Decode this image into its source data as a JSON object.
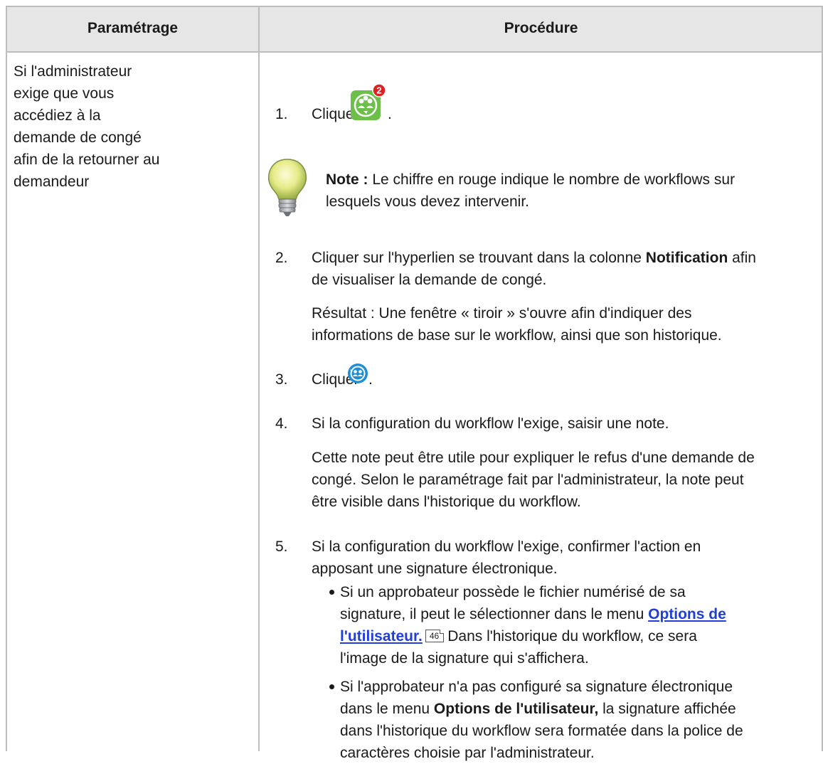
{
  "table": {
    "headers": {
      "col1": "Paramétrage",
      "col2": "Procédure"
    },
    "setting": [
      "Si l'administrateur",
      "exige que vous",
      "accédiez à la",
      "demande de congé",
      "afin de la retourner au",
      "demandeur"
    ],
    "steps": {
      "s1": {
        "num": "1.",
        "text": "Cliquer",
        "badge": "2",
        "after": "."
      },
      "note": {
        "label": "Note :",
        "line1": " Le chiffre en rouge indique le nombre de workflows sur",
        "line2": "lesquels vous devez intervenir."
      },
      "s2": {
        "num": "2.",
        "line1a": "Cliquer sur l'hyperlien se trouvant dans la colonne ",
        "line1b": "Notification",
        "line1c": " afin",
        "line2": "de visualiser la demande de congé.",
        "result1": "Résultat : Une fenêtre « tiroir » s'ouvre afin d'indiquer des",
        "result2": "informations de base sur le workflow, ainsi que son historique."
      },
      "s3": {
        "num": "3.",
        "text": "Cliquer",
        "after": "."
      },
      "s4": {
        "num": "4.",
        "line1": "Si la configuration du workflow l'exige, saisir une note.",
        "p1": "Cette note peut être utile pour expliquer le refus d'une demande de",
        "p2": "congé. Selon le paramétrage fait par l'administrateur, la note peut",
        "p3": "être visible dans l'historique du workflow."
      },
      "s5": {
        "num": "5.",
        "line1": "Si la configuration du workflow l'exige, confirmer l'action en",
        "line2": "apposant une signature électronique.",
        "b1": {
          "l1": "Si un approbateur possède le fichier numérisé de sa",
          "l2a": "signature, il peut le sélectionner dans le menu ",
          "l2link": "Options de",
          "l3link": "l'utilisateur.",
          "pageref": "46",
          "l3b": "Dans l'historique du workflow, ce sera",
          "l4": "l'image de la signature qui s'affichera."
        },
        "b2": {
          "l1": "Si l'approbateur n'a pas configuré sa signature électronique",
          "l2a": "dans le menu ",
          "l2b": "Options de l'utilisateur,",
          "l2c": " la signature affichée",
          "l3": "dans l'historique du workflow sera formatée dans la police de",
          "l4": "caractères choisie par l'administrateur."
        }
      }
    },
    "icons": {
      "workflow": "workflow-people-icon",
      "note": "lightbulb-icon",
      "return": "return-to-requester-icon"
    },
    "colors": {
      "header_bg": "#e6e6e6",
      "link": "#1f3fd6",
      "icon_green": "#6cc04a",
      "icon_blue": "#1e8fd6",
      "badge_red": "#e02020"
    }
  }
}
